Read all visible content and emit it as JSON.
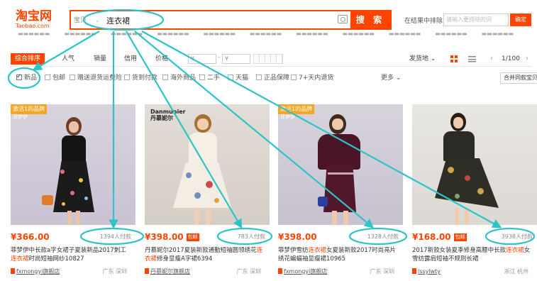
{
  "header": {
    "logo_cn": "淘宝网",
    "logo_en": "Taobao.com",
    "search_category": "宝贝",
    "search_value": "连衣裙",
    "search_button": "搜 索",
    "in_result_label": "在结果中排除",
    "in_result_placeholder": "请输入要排除的词",
    "in_result_button": "确定"
  },
  "sortbar": {
    "items": [
      "综合排序",
      "人气",
      "销量",
      "信用",
      "价格"
    ],
    "price_min_placeholder": "¥",
    "price_max_placeholder": "¥",
    "price_dash": "-",
    "ship_from": "发货地",
    "page_indicator": "1/100"
  },
  "filters": {
    "items": [
      "新品",
      "包邮",
      "赠送退货运费险",
      "货到付款",
      "海外商品",
      "二手",
      "天猫",
      "正品保障",
      "7+天内退货"
    ],
    "more": "更多",
    "merge_button": "合并同款宝贝"
  },
  "products": [
    {
      "price": "¥366.00",
      "tag": "",
      "paid": "1394人付款",
      "title_pre": "菲梦伊中长款a字女裙子夏装新品2017刺工",
      "title_kw": "连衣裙",
      "title_post": "时尚短袖网纱10827",
      "title_kw_first": false,
      "shop": "fxmongyi旗舰店",
      "location": "广东 深圳",
      "badge": "激活1的品牌",
      "badge_sub": "菲梦伊"
    },
    {
      "price": "¥398.00",
      "tag": "包邮",
      "paid": "783人付款",
      "title_pre": "丹慕妮尔2017夏装新款通勤短袖圆领绣花",
      "title_kw": "连衣裙",
      "title_post": "修身显瘦A字裙6394",
      "title_kw_first": true,
      "shop": "丹慕妮尔旗舰店",
      "location": "广东 深圳",
      "badge": "",
      "badge_sub": "",
      "photo_logo": "Danmunier\n丹慕妮尔"
    },
    {
      "price": "¥398.00",
      "tag": "",
      "paid": "1328人付款",
      "title_pre": "菲梦伊雪纺",
      "title_kw": "连衣裙",
      "title_post": "女夏装新款2017时尚亮片绣花蝙蝠袖显瘦裙10965",
      "title_kw_first": false,
      "shop": "fxmongyi旗舰店",
      "location": "广东 深圳",
      "badge": "激活1的品牌",
      "badge_sub": "菲梦伊"
    },
    {
      "price": "¥168.00",
      "tag": "包邮",
      "paid": "3938人付款",
      "title_pre": "2017新款女装夏季修身高腰中长款",
      "title_kw": "连衣裙",
      "title_post": "女雪纺露肩短袖不规则长裙",
      "title_kw_first": false,
      "shop": "lssylwty",
      "location": "浙江 杭州",
      "badge": "",
      "badge_sub": ""
    }
  ],
  "colors": {
    "brand": "#ff4400",
    "annotation": "#2ec4c6"
  }
}
